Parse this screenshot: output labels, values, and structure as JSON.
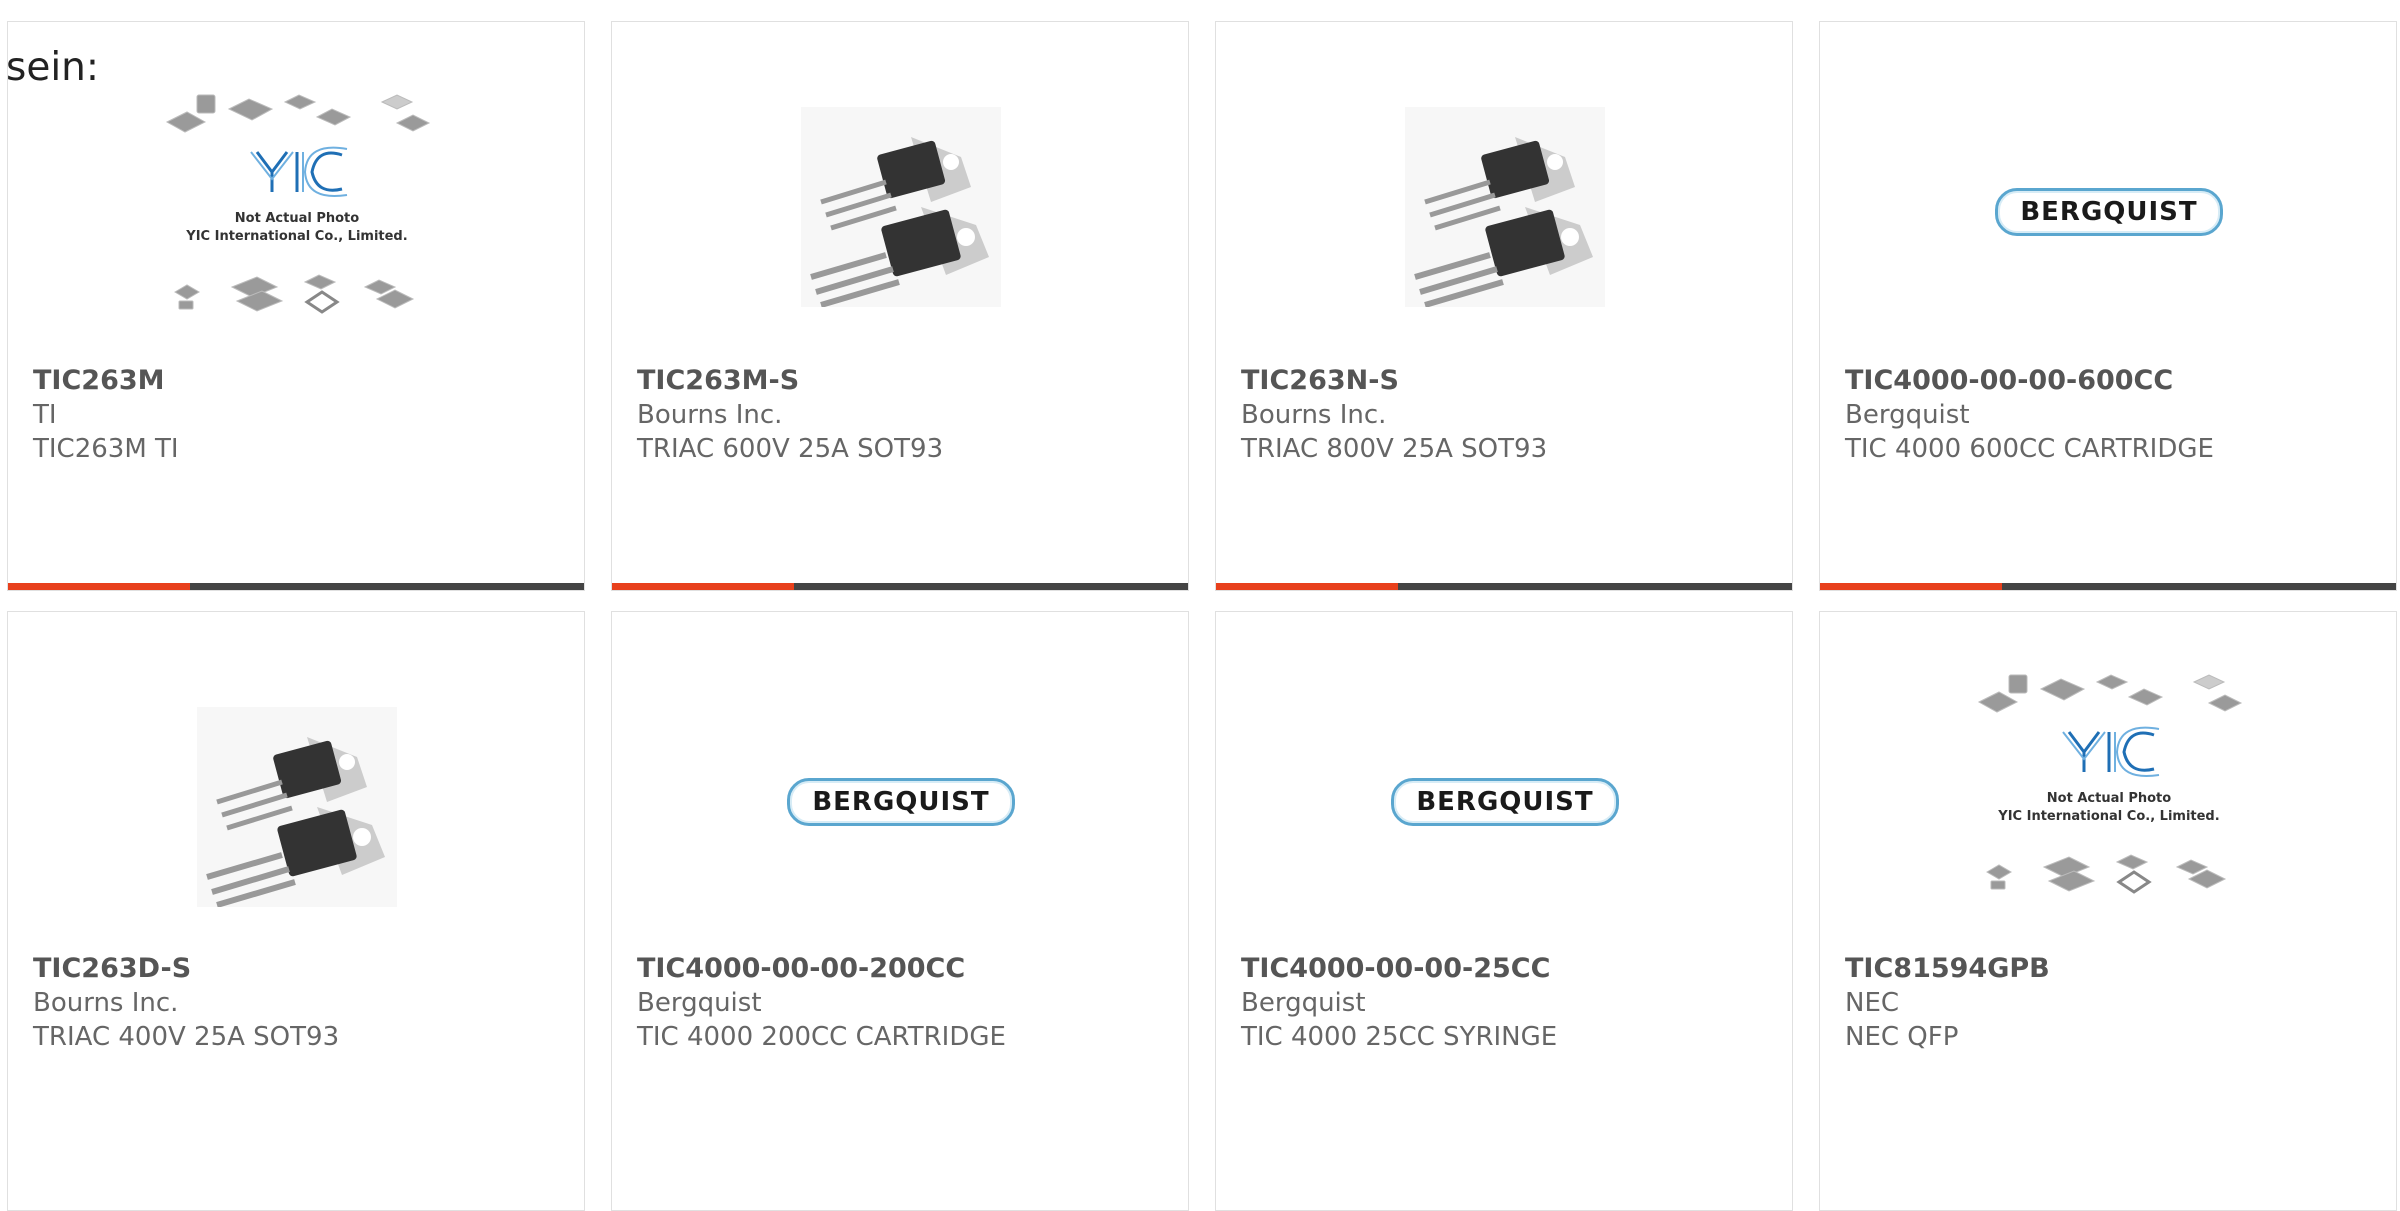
{
  "page": {
    "partial_text": "sein:"
  },
  "colors": {
    "accent": "#e8401c",
    "bar": "#444444",
    "logo_blue": "#3a86c6"
  },
  "products": [
    {
      "part": "TIC263M",
      "manufacturer": "TI",
      "description": "TIC263M TI",
      "image": "yic-placeholder",
      "placeholder": {
        "line1": "Not Actual Photo",
        "line2": "YIC International Co., Limited."
      }
    },
    {
      "part": "TIC263M-S",
      "manufacturer": "Bourns Inc.",
      "description": "TRIAC 600V 25A SOT93",
      "image": "to-package-photo"
    },
    {
      "part": "TIC263N-S",
      "manufacturer": "Bourns Inc.",
      "description": "TRIAC 800V 25A SOT93",
      "image": "to-package-photo"
    },
    {
      "part": "TIC4000-00-00-600CC",
      "manufacturer": "Bergquist",
      "description": "TIC 4000 600CC CARTRIDGE",
      "image": "bergquist-logo",
      "logo_text": "BERGQUIST"
    },
    {
      "part": "TIC263D-S",
      "manufacturer": "Bourns Inc.",
      "description": "TRIAC 400V 25A SOT93",
      "image": "to-package-photo"
    },
    {
      "part": "TIC4000-00-00-200CC",
      "manufacturer": "Bergquist",
      "description": "TIC 4000 200CC CARTRIDGE",
      "image": "bergquist-logo",
      "logo_text": "BERGQUIST"
    },
    {
      "part": "TIC4000-00-00-25CC",
      "manufacturer": "Bergquist",
      "description": "TIC 4000 25CC SYRINGE",
      "image": "bergquist-logo",
      "logo_text": "BERGQUIST"
    },
    {
      "part": "TIC81594GPB",
      "manufacturer": "NEC",
      "description": "NEC QFP",
      "image": "yic-placeholder",
      "placeholder": {
        "line1": "Not Actual Photo",
        "line2": "YIC International Co., Limited."
      }
    }
  ]
}
